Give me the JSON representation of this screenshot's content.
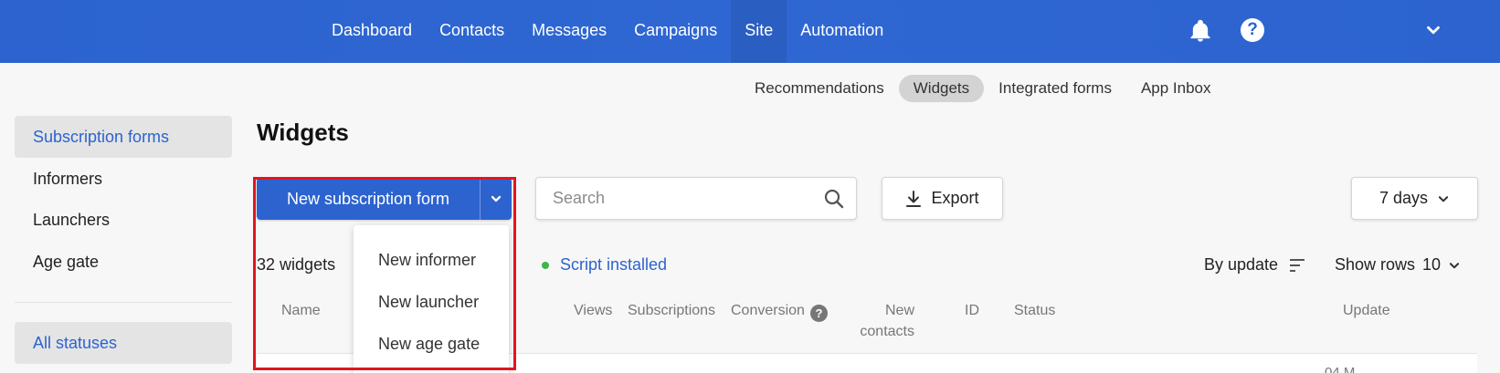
{
  "nav": {
    "items": [
      "Dashboard",
      "Contacts",
      "Messages",
      "Campaigns",
      "Site",
      "Automation"
    ],
    "active": "Site"
  },
  "subnav": {
    "items": [
      "Recommendations",
      "Widgets",
      "Integrated forms",
      "App Inbox"
    ],
    "active": "Widgets"
  },
  "sidebar": {
    "items": [
      "Subscription forms",
      "Informers",
      "Launchers",
      "Age gate"
    ],
    "status_filter": "All statuses"
  },
  "main": {
    "title": "Widgets",
    "new_button": "New subscription form",
    "search_placeholder": "Search",
    "export": "Export",
    "period": "7 days",
    "count": "32",
    "count_label": "widgets",
    "script_status": "Script installed",
    "sort": "By update",
    "rows_label": "Show rows",
    "rows_value": "10",
    "columns": {
      "name": "Name",
      "views": "Views",
      "subscriptions": "Subscriptions",
      "conversion": "Conversion",
      "new_contacts_1": "New",
      "new_contacts_2": "contacts",
      "id": "ID",
      "status": "Status",
      "update": "Update"
    },
    "peek_text": "04.M..."
  },
  "dropdown": {
    "items": [
      "New informer",
      "New launcher",
      "New age gate"
    ]
  },
  "colors": {
    "brand": "#2c63cf",
    "highlight": "#e3141f",
    "script_ok": "#3cb64a"
  }
}
